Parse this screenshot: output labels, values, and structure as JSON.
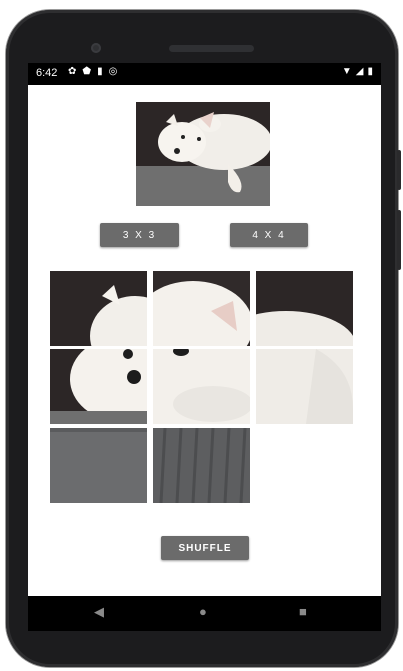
{
  "status_bar": {
    "time": "6:42",
    "left_icons": [
      "settings-icon",
      "shield-icon",
      "sim-icon",
      "sync-icon"
    ],
    "right_icons": [
      "wifi-icon",
      "signal-icon",
      "battery-icon"
    ]
  },
  "preview": {
    "image": "dog-photo"
  },
  "buttons": {
    "grid_3x3": "3 X 3",
    "grid_4x4": "4 X 4",
    "shuffle": "SHUFFLE"
  },
  "puzzle": {
    "grid": "3x3",
    "tiles": [
      {
        "piece": 1
      },
      {
        "piece": 2
      },
      {
        "piece": 3
      },
      {
        "piece": 4
      },
      {
        "piece": 5
      },
      {
        "piece": 6
      },
      {
        "piece": 7
      },
      {
        "piece": 8
      },
      {
        "piece": null
      }
    ]
  },
  "nav_bar": {
    "back": "◀",
    "home": "●",
    "recents": "■"
  },
  "colors": {
    "button_bg": "#6b6b6b",
    "screen_bg": "#ffffff",
    "phone_body": "#1c1c1e"
  }
}
